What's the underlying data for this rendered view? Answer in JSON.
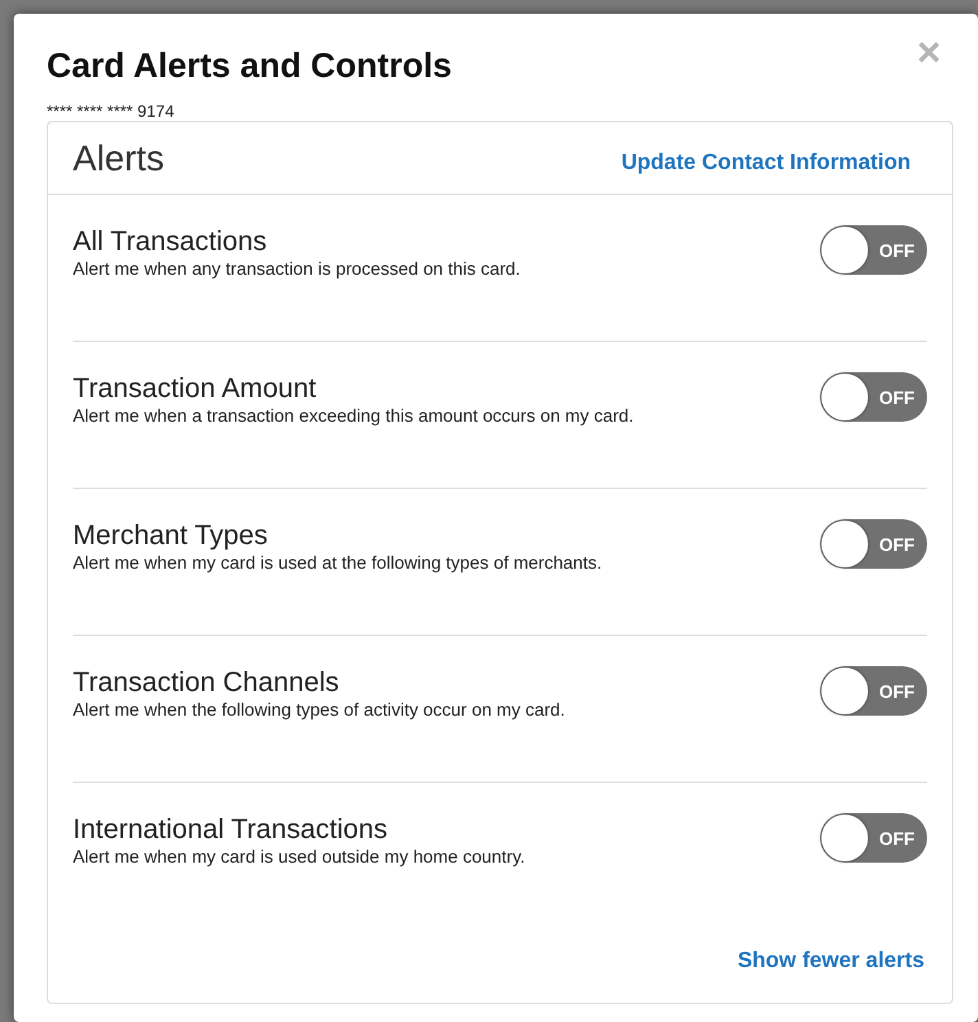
{
  "dialog": {
    "title": "Card Alerts and Controls",
    "card_number": "**** **** **** 9174",
    "close": "×"
  },
  "alerts_card": {
    "title": "Alerts",
    "contact_link": "Update Contact Information",
    "alerts": [
      {
        "title": "All Transactions",
        "description": "Alert me when any transaction is processed on this card.",
        "on": false,
        "switch_label": "OFF"
      },
      {
        "title": "Transaction Amount",
        "description": "Alert me when a transaction exceeding this amount occurs on my card.",
        "on": false,
        "switch_label": "OFF"
      },
      {
        "title": "Merchant Types",
        "description": "Alert me when my card is used at the following types of merchants.",
        "on": false,
        "switch_label": "OFF"
      },
      {
        "title": "Transaction Channels",
        "description": "Alert me when the following types of activity occur on my card.",
        "on": false,
        "switch_label": "OFF"
      },
      {
        "title": "International Transactions",
        "description": "Alert me when my card is used outside my home country.",
        "on": false,
        "switch_label": "OFF"
      }
    ],
    "footer_link": "Show fewer alerts"
  }
}
